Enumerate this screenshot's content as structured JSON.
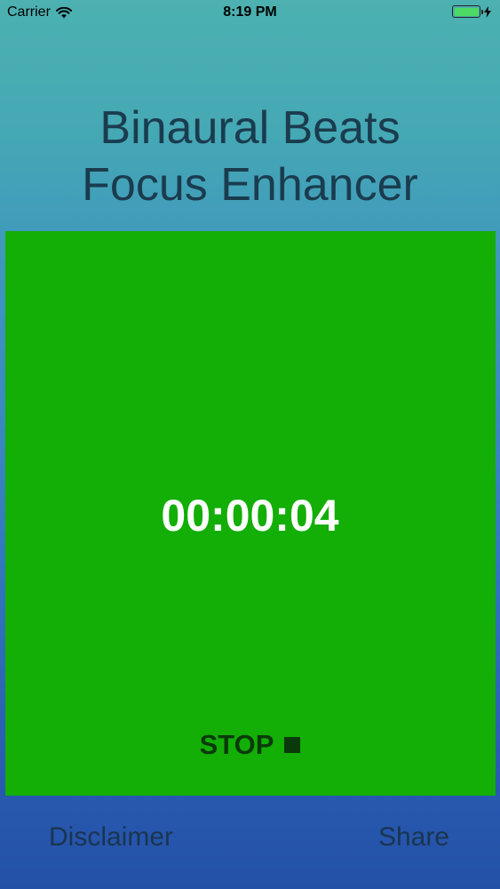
{
  "status_bar": {
    "carrier": "Carrier",
    "time": "8:19 PM",
    "icons": [
      "wifi-icon",
      "battery-icon",
      "charging-icon"
    ],
    "battery_level": 1.0
  },
  "header": {
    "title_line1": "Binaural Beats",
    "title_line2": "Focus Enhancer"
  },
  "timer": {
    "elapsed": "00:00:04",
    "stop_label": "STOP",
    "stop_icon": "stop-icon"
  },
  "footer": {
    "disclaimer_label": "Disclaimer",
    "share_label": "Share"
  },
  "colors": {
    "panel": "#13ae06",
    "title_text": "#1a3c4e",
    "stop_text": "#0a3a0a",
    "footer_text": "#1a3550",
    "battery": "#4cd964"
  }
}
